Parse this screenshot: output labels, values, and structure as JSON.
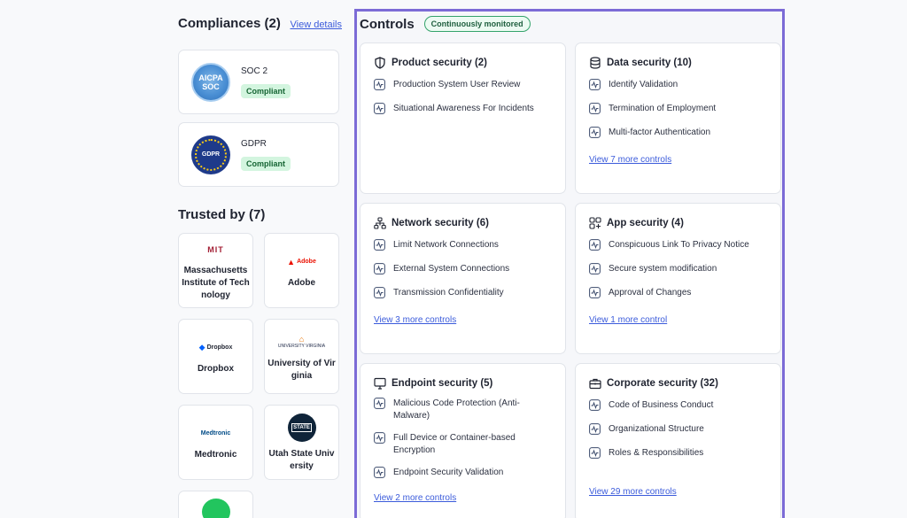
{
  "compliances": {
    "title": "Compliances (2)",
    "view_details": "View details",
    "items": [
      {
        "name": "SOC 2",
        "status": "Compliant",
        "logo_text": "AICPA SOC"
      },
      {
        "name": "GDPR",
        "status": "Compliant",
        "logo_text": "GDPR"
      }
    ]
  },
  "trusted": {
    "title": "Trusted by (7)",
    "items": [
      {
        "name": "Massachusetts Institute of Technology",
        "logo_text": "MIT",
        "logo_color": "#a31f34"
      },
      {
        "name": "Adobe",
        "logo_text": "Adobe",
        "logo_color": "#eb1000"
      },
      {
        "name": "Dropbox",
        "logo_text": "Dropbox",
        "logo_color": "#0061fe"
      },
      {
        "name": "University of Virginia",
        "logo_text": "UNIVERSITY VIRGINIA",
        "logo_color": "#232d4b"
      },
      {
        "name": "Medtronic",
        "logo_text": "Medtronic",
        "logo_color": "#004b87"
      },
      {
        "name": "Utah State University",
        "logo_text": "STATE",
        "logo_color": "#0f2439"
      }
    ]
  },
  "controls": {
    "title": "Controls",
    "badge": "Continuously monitored",
    "cards": [
      {
        "title": "Product security (2)",
        "icon": "shield-icon",
        "items": [
          "Production System User Review",
          "Situational Awareness For Incidents"
        ],
        "more": ""
      },
      {
        "title": "Data security (10)",
        "icon": "database-icon",
        "items": [
          "Identify Validation",
          "Termination of Employment",
          "Multi-factor Authentication"
        ],
        "more": "View 7 more controls"
      },
      {
        "title": "Network security (6)",
        "icon": "network-icon",
        "items": [
          "Limit Network Connections",
          "External System Connections",
          "Transmission Confidentiality"
        ],
        "more": "View 3 more controls"
      },
      {
        "title": "App security (4)",
        "icon": "apps-icon",
        "items": [
          "Conspicuous Link To Privacy Notice",
          "Secure system modification",
          "Approval of Changes"
        ],
        "more": "View 1 more control"
      },
      {
        "title": "Endpoint security (5)",
        "icon": "monitor-icon",
        "items": [
          "Malicious Code Protection (Anti-Malware)",
          "Full Device or Container-based Encryption",
          "Endpoint Security Validation"
        ],
        "more": "View 2 more controls"
      },
      {
        "title": "Corporate security (32)",
        "icon": "briefcase-icon",
        "items": [
          "Code of Business Conduct",
          "Organizational Structure",
          "Roles & Responsibilities"
        ],
        "more": "View 29 more controls"
      }
    ]
  }
}
